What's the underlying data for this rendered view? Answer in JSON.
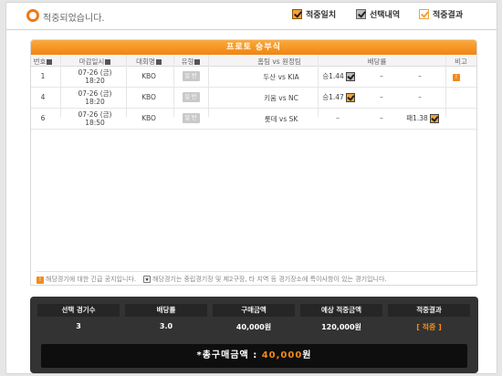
{
  "header": {
    "headline": "적중되었습니다."
  },
  "legend": [
    {
      "label": "적중일치",
      "style": "orange"
    },
    {
      "label": "선택내역",
      "style": "gray"
    },
    {
      "label": "적중결과",
      "style": "outline"
    }
  ],
  "table": {
    "title": "프로토 승부식",
    "columns": [
      "번호",
      "마감일시",
      "대회명",
      "유형",
      "홈팀 vs 원정팀",
      "배당률",
      "비고"
    ],
    "rows": [
      {
        "no": "1",
        "date": "07-26 (금)",
        "time": "18:20",
        "league": "KBO",
        "type": "일 반",
        "match": "두산 vs KIA",
        "odd1": "승1.44",
        "odd1_state": "gray",
        "odd2": "–",
        "odd3": "–",
        "note": "!"
      },
      {
        "no": "4",
        "date": "07-26 (금)",
        "time": "18:20",
        "league": "KBO",
        "type": "일 반",
        "match": "키움 vs NC",
        "odd1": "승1.47",
        "odd1_state": "orange",
        "odd2": "–",
        "odd3": "–",
        "note": ""
      },
      {
        "no": "6",
        "date": "07-26 (금)",
        "time": "18:50",
        "league": "KBO",
        "type": "일 반",
        "match": "롯데 vs SK",
        "odd1": "–",
        "odd2": "–",
        "odd3": "패1.38",
        "odd3_state": "orange",
        "note": ""
      }
    ]
  },
  "notices": {
    "urgent": "해당경기에 대한 긴급 공지입니다.",
    "special": "해당경기는 중립경기장 및 제2구장, 타 지역 등 경기장소에 특이사항이 있는 경기입니다."
  },
  "summary": {
    "columns": [
      {
        "label": "선택 경기수",
        "value": "3"
      },
      {
        "label": "배당률",
        "value": "3.0"
      },
      {
        "label": "구매금액",
        "value": "40,000원"
      },
      {
        "label": "예상 적중금액",
        "value": "120,000원"
      },
      {
        "label": "적중결과",
        "value": "[ 적중 ]"
      }
    ],
    "total_label": "*총구매금액 :",
    "total_amount": "40,000",
    "total_unit": "원"
  },
  "colors": {
    "accent": "#f08a1e",
    "dark": "#333333"
  }
}
